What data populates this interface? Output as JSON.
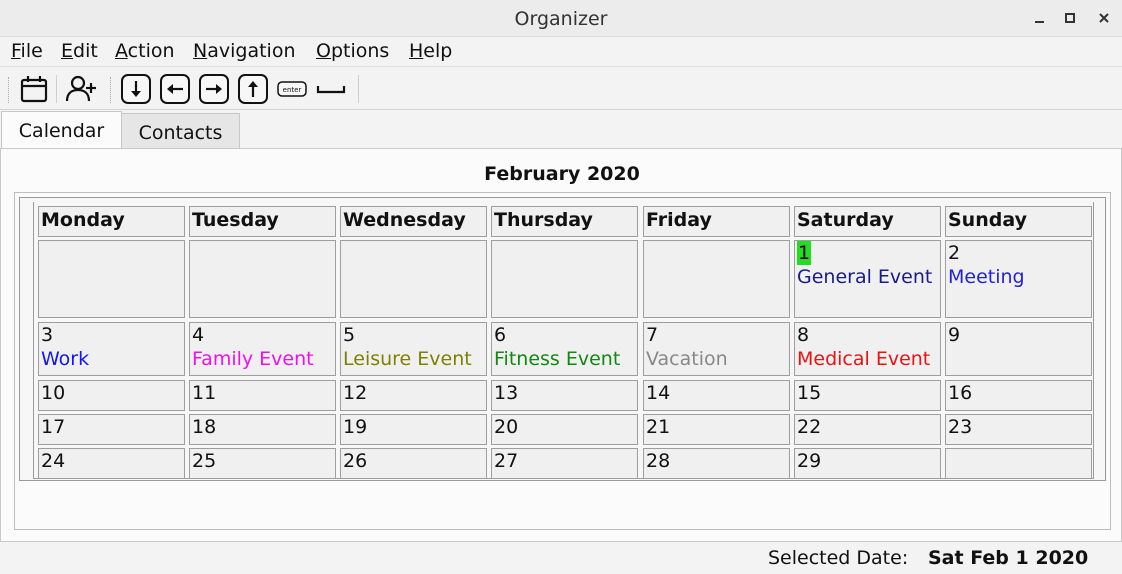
{
  "window": {
    "title": "Organizer",
    "controls": [
      "minimize",
      "maximize",
      "close"
    ]
  },
  "menu": [
    {
      "id": "file",
      "label": "File"
    },
    {
      "id": "edit",
      "label": "Edit"
    },
    {
      "id": "action",
      "label": "Action"
    },
    {
      "id": "navigation",
      "label": "Navigation"
    },
    {
      "id": "options",
      "label": "Options"
    },
    {
      "id": "help",
      "label": "Help"
    }
  ],
  "toolbar": {
    "buttons": [
      {
        "icon": "calendar-icon"
      },
      {
        "icon": "add-contact-icon"
      },
      {
        "icon": "arrow-down-icon"
      },
      {
        "icon": "arrow-left-icon"
      },
      {
        "icon": "arrow-right-icon"
      },
      {
        "icon": "arrow-up-icon"
      },
      {
        "icon": "enter-key-icon",
        "label": "enter"
      },
      {
        "icon": "space-key-icon"
      }
    ]
  },
  "tabs": [
    {
      "label": "Calendar",
      "active": true
    },
    {
      "label": "Contacts",
      "active": false
    }
  ],
  "calendar": {
    "month_title": "February 2020",
    "weekdays": [
      "Monday",
      "Tuesday",
      "Wednesday",
      "Thursday",
      "Friday",
      "Saturday",
      "Sunday"
    ],
    "selected_color": "#22dd22",
    "weeks": [
      [
        {
          "day": "",
          "events": []
        },
        {
          "day": "",
          "events": []
        },
        {
          "day": "",
          "events": []
        },
        {
          "day": "",
          "events": []
        },
        {
          "day": "",
          "events": []
        },
        {
          "day": "1",
          "selected": true,
          "events": [
            {
              "text": "General Event",
              "color": "#1a1a8c"
            }
          ]
        },
        {
          "day": "2",
          "events": [
            {
              "text": "Meeting",
              "color": "#2222dd"
            }
          ]
        }
      ],
      [
        {
          "day": "3",
          "events": [
            {
              "text": "Work",
              "color": "#1515ee"
            }
          ]
        },
        {
          "day": "4",
          "events": [
            {
              "text": "Family Event",
              "color": "#ee11ee"
            }
          ]
        },
        {
          "day": "5",
          "events": [
            {
              "text": "Leisure Event",
              "color": "#808000"
            }
          ]
        },
        {
          "day": "6",
          "events": [
            {
              "text": "Fitness Event",
              "color": "#118811"
            }
          ]
        },
        {
          "day": "7",
          "events": [
            {
              "text": "Vacation",
              "color": "#888888"
            }
          ]
        },
        {
          "day": "8",
          "events": [
            {
              "text": "Medical Event",
              "color": "#ee1111"
            }
          ]
        },
        {
          "day": "9",
          "events": []
        }
      ],
      [
        {
          "day": "10",
          "events": []
        },
        {
          "day": "11",
          "events": []
        },
        {
          "day": "12",
          "events": []
        },
        {
          "day": "13",
          "events": []
        },
        {
          "day": "14",
          "events": []
        },
        {
          "day": "15",
          "events": []
        },
        {
          "day": "16",
          "events": []
        }
      ],
      [
        {
          "day": "17",
          "events": []
        },
        {
          "day": "18",
          "events": []
        },
        {
          "day": "19",
          "events": []
        },
        {
          "day": "20",
          "events": []
        },
        {
          "day": "21",
          "events": []
        },
        {
          "day": "22",
          "events": []
        },
        {
          "day": "23",
          "events": []
        }
      ],
      [
        {
          "day": "24",
          "events": []
        },
        {
          "day": "25",
          "events": []
        },
        {
          "day": "26",
          "events": []
        },
        {
          "day": "27",
          "events": []
        },
        {
          "day": "28",
          "events": []
        },
        {
          "day": "29",
          "events": []
        },
        {
          "day": "",
          "events": []
        }
      ]
    ]
  },
  "status": {
    "label": "Selected Date:",
    "value": "Sat Feb 1 2020"
  }
}
